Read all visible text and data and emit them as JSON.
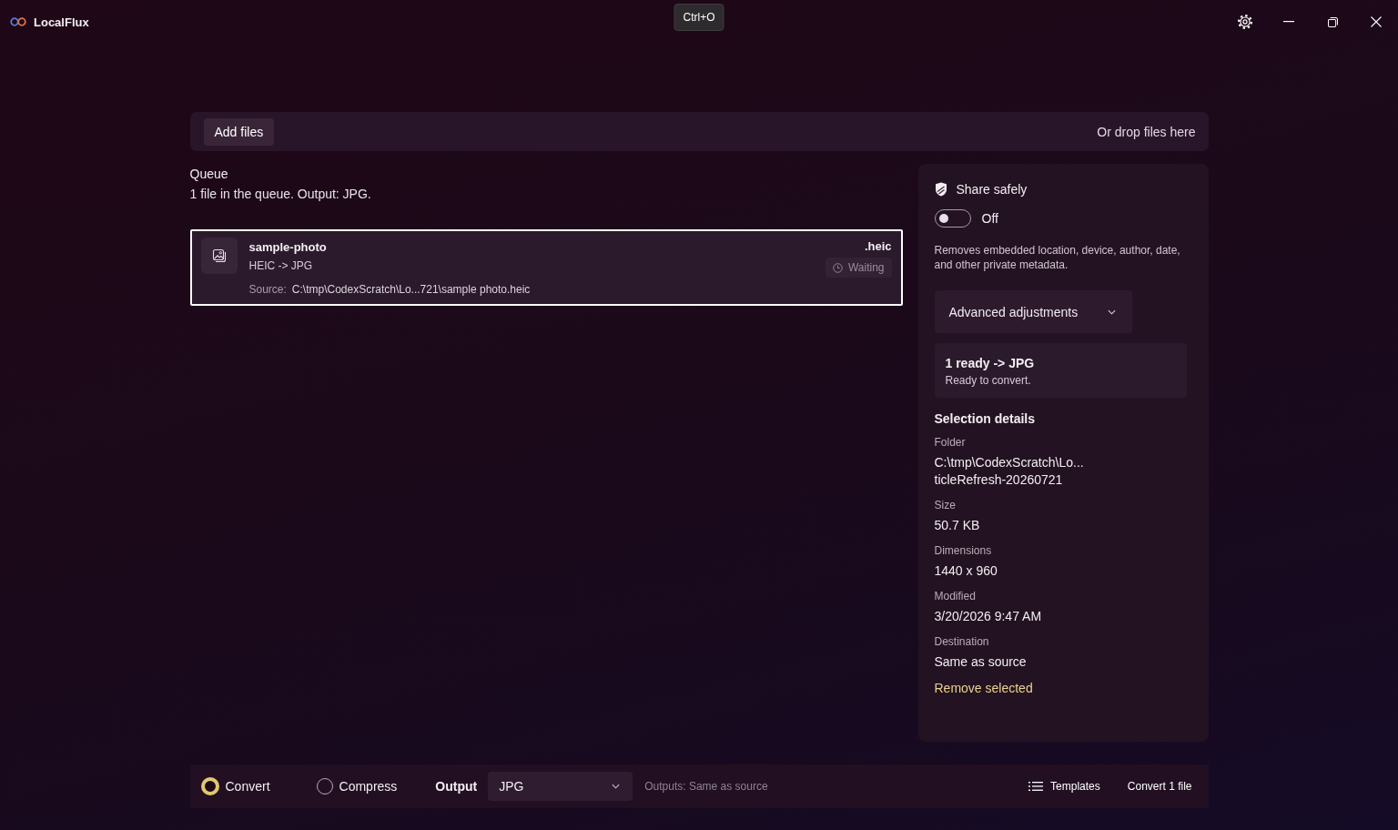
{
  "window": {
    "app_name": "LocalFlux",
    "tooltip": "Ctrl+O"
  },
  "drop_bar": {
    "add_button": "Add files",
    "hint": "Or drop files here"
  },
  "queue": {
    "title": "Queue",
    "summary": "1 file in the queue. Output: JPG.",
    "items": [
      {
        "name": "sample-photo",
        "conversion": "HEIC -> JPG",
        "source_label": "Source:",
        "source_path": "C:\\tmp\\CodexScratch\\Lo...721\\sample photo.heic",
        "extension": ".heic",
        "status": "Waiting",
        "selected": true
      }
    ]
  },
  "share_safely": {
    "title": "Share safely",
    "on": false,
    "state_label": "Off",
    "description": "Removes embedded location, device, author, date, and other private metadata."
  },
  "advanced": {
    "label": "Advanced adjustments",
    "expanded": false
  },
  "ready_card": {
    "title": "1 ready -> JPG",
    "subtitle": "Ready to convert."
  },
  "selection_details": {
    "title": "Selection details",
    "fields": [
      {
        "label": "Folder",
        "value": "C:\\tmp\\CodexScratch\\Lo...\nticleRefresh-20260721"
      },
      {
        "label": "Size",
        "value": "50.7 KB"
      },
      {
        "label": "Dimensions",
        "value": "1440 x 960"
      },
      {
        "label": "Modified",
        "value": "3/20/2026 9:47 AM"
      },
      {
        "label": "Destination",
        "value": "Same as source"
      }
    ],
    "remove_link": "Remove selected"
  },
  "bottom_bar": {
    "modes": [
      {
        "label": "Convert",
        "selected": true
      },
      {
        "label": "Compress",
        "selected": false
      }
    ],
    "output_label": "Output",
    "output_format": "JPG",
    "outputs_note": "Outputs: Same as source",
    "templates": "Templates",
    "convert_button": "Convert 1 file"
  }
}
